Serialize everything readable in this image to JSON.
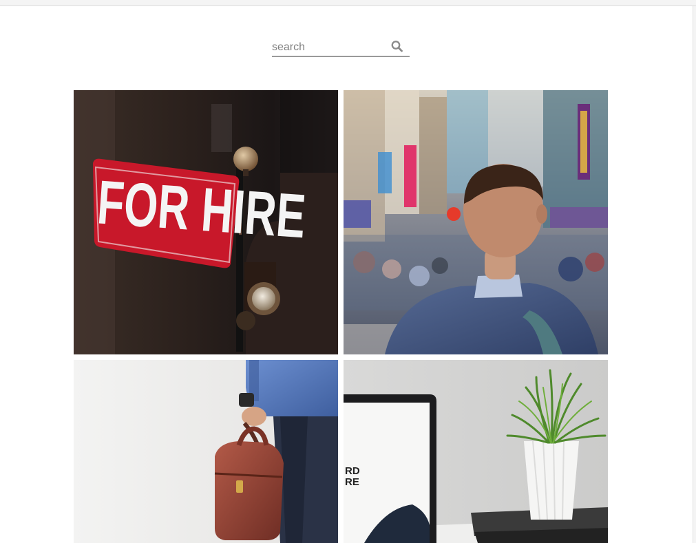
{
  "search": {
    "placeholder": "search",
    "icon": "search-icon"
  },
  "gallery": {
    "tiles": [
      {
        "subject": "for-hire-sign",
        "sign_text": "FOR HIRE"
      },
      {
        "subject": "man-in-city-street"
      },
      {
        "subject": "businessman-with-briefcase"
      },
      {
        "subject": "laptop-and-plant",
        "screen_text_line1": "RD",
        "screen_text_line2": "RE"
      }
    ]
  },
  "colors": {
    "sign_red": "#c8182a",
    "underline": "#9a9a9a",
    "background": "#ffffff"
  }
}
